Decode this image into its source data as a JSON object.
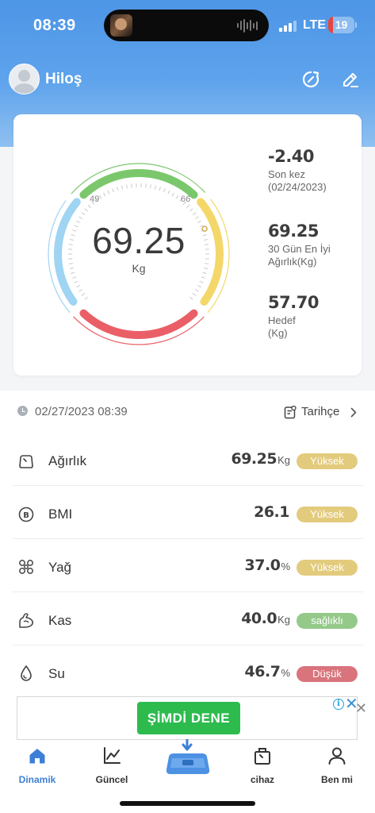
{
  "status_bar": {
    "time": "08:39",
    "network": "LTE",
    "battery_level": "19"
  },
  "header": {
    "username": "Hiloş",
    "icons": [
      "refresh-icon",
      "edit-icon"
    ]
  },
  "summary": {
    "weight_value": "69.25",
    "weight_unit": "Kg",
    "gauge_left_label": "49",
    "gauge_right_label": "66",
    "colors": {
      "normal": "#7bc86c",
      "high": "#f3d769",
      "obese": "#ea5f67",
      "low": "#9fd4f2"
    },
    "stats": [
      {
        "value": "-2.40",
        "label_line1": "Son kez",
        "label_line2": "(02/24/2023)"
      },
      {
        "value": "69.25",
        "label_line1": "30 Gün En İyi",
        "label_line2": "Ağırlık(Kg)"
      },
      {
        "value": "57.70",
        "label_line1": "Hedef",
        "label_line2": "(Kg)"
      }
    ]
  },
  "measure": {
    "datetime": "02/27/2023 08:39",
    "history_label": "Tarihçe"
  },
  "metrics": [
    {
      "icon": "weight-icon",
      "name": "Ağırlık",
      "value": "69.25",
      "unit": "Kg",
      "status": "Yüksek",
      "status_color": "#e3cb7d"
    },
    {
      "icon": "bmi-icon",
      "name": "BMI",
      "value": "26.1",
      "unit": "",
      "status": "Yüksek",
      "status_color": "#e3cb7d"
    },
    {
      "icon": "fat-icon",
      "name": "Yağ",
      "value": "37.0",
      "unit": "%",
      "status": "Yüksek",
      "status_color": "#e3cb7d"
    },
    {
      "icon": "muscle-icon",
      "name": "Kas",
      "value": "40.0",
      "unit": "Kg",
      "status": "sağlıklı",
      "status_color": "#95c98a"
    },
    {
      "icon": "water-icon",
      "name": "Su",
      "value": "46.7",
      "unit": "%",
      "status": "Düşük",
      "status_color": "#d9747c"
    }
  ],
  "ad": {
    "button_label": "ŞİMDİ DENE",
    "info_glyph": "i",
    "close_glyph": "✕",
    "outer_close_glyph": "✕"
  },
  "tabs": [
    {
      "label": "Dinamik",
      "icon": "home-icon",
      "active": true
    },
    {
      "label": "Güncel",
      "icon": "chart-icon",
      "active": false
    },
    {
      "label": "",
      "icon": "scale-icon",
      "active": false
    },
    {
      "label": "cihaz",
      "icon": "bag-icon",
      "active": false
    },
    {
      "label": "Ben mi",
      "icon": "person-icon",
      "active": false
    }
  ]
}
